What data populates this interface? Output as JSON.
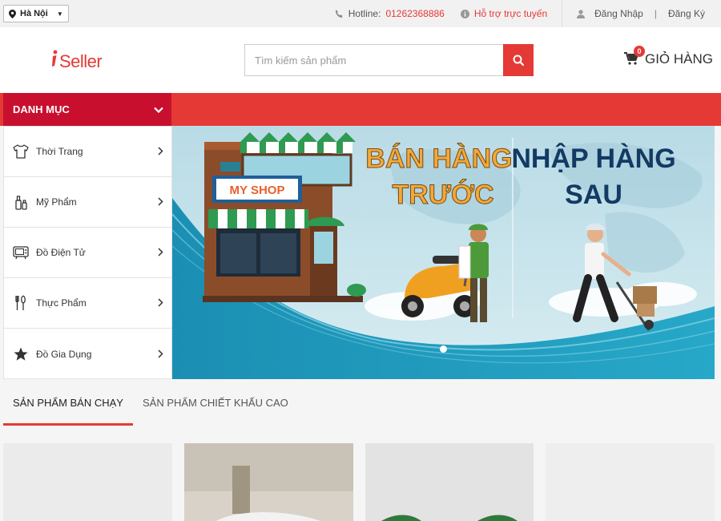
{
  "topbar": {
    "location": "Hà Nội",
    "hotline_label": "Hotline:",
    "hotline_number": "01262368886",
    "support": "Hỗ trợ trực tuyến",
    "login": "Đăng Nhập",
    "divider": "|",
    "register": "Đăng Ký"
  },
  "header": {
    "logo_text": "Seller",
    "search_placeholder": "Tìm kiếm sản phẩm",
    "cart_label": "GIỎ HÀNG",
    "cart_count": "0"
  },
  "nav": {
    "category_title": "DANH MỤC"
  },
  "categories": [
    {
      "label": "Thời Trang",
      "icon": "shirt-icon"
    },
    {
      "label": "Mỹ Phẩm",
      "icon": "cosmetics-icon"
    },
    {
      "label": "Đồ Điện Tử",
      "icon": "tv-icon"
    },
    {
      "label": "Thực Phẩm",
      "icon": "cutlery-icon"
    },
    {
      "label": "Đồ Gia Dụng",
      "icon": "star-icon"
    }
  ],
  "banner": {
    "shop_sign": "MY SHOP",
    "left_line1": "BÁN HÀNG",
    "left_line2": "TRƯỚC",
    "right_line1": "NHẬP HÀNG",
    "right_line2": "SAU"
  },
  "tabs": [
    {
      "label": "SẢN PHẨM BÁN CHẠY",
      "active": true
    },
    {
      "label": "SẢN PHẨM CHIẾT KHẤU CAO",
      "active": false
    }
  ],
  "colors": {
    "accent": "#e53935",
    "accent_dark": "#c8102e"
  }
}
